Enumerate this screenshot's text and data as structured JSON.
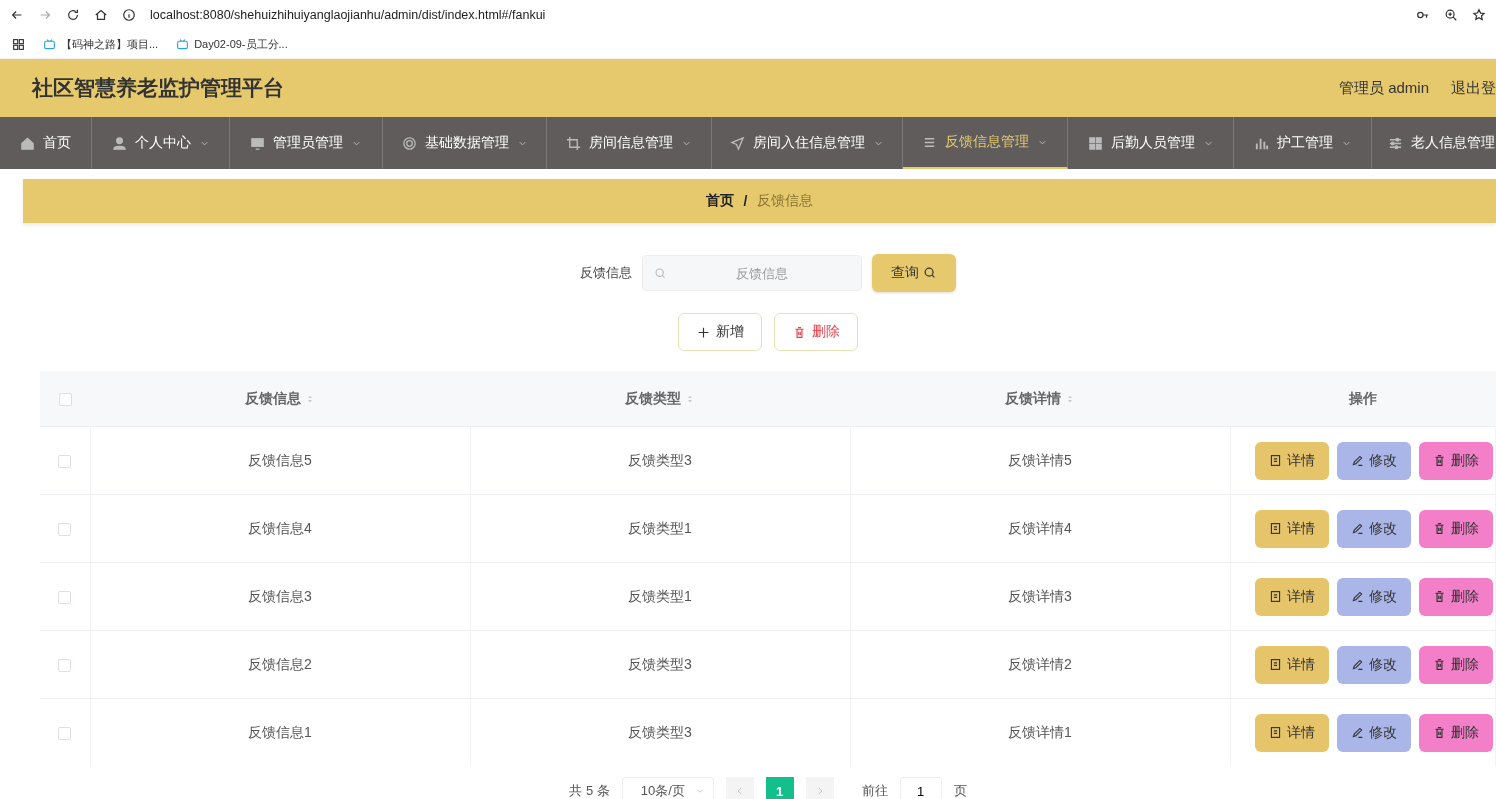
{
  "browser": {
    "url": "localhost:8080/shehuizhihuiyanglaojianhu/admin/dist/index.html#/fankui",
    "bookmarks": [
      "【码神之路】项目...",
      "Day02-09-员工分..."
    ]
  },
  "header": {
    "title": "社区智慧养老监护管理平台",
    "user": "管理员 admin",
    "logout": "退出登"
  },
  "nav": {
    "items": [
      {
        "label": "首页",
        "selected": false,
        "has_dropdown": false
      },
      {
        "label": "个人中心",
        "selected": false,
        "has_dropdown": true
      },
      {
        "label": "管理员管理",
        "selected": false,
        "has_dropdown": true
      },
      {
        "label": "基础数据管理",
        "selected": false,
        "has_dropdown": true
      },
      {
        "label": "房间信息管理",
        "selected": false,
        "has_dropdown": true
      },
      {
        "label": "房间入住信息管理",
        "selected": false,
        "has_dropdown": true
      },
      {
        "label": "反馈信息管理",
        "selected": true,
        "has_dropdown": true
      },
      {
        "label": "后勤人员管理",
        "selected": false,
        "has_dropdown": true
      },
      {
        "label": "护工管理",
        "selected": false,
        "has_dropdown": true
      },
      {
        "label": "老人信息管理",
        "selected": false,
        "has_dropdown": false
      }
    ]
  },
  "breadcrumb": {
    "items": [
      "首页",
      "反馈信息"
    ],
    "separator": "/"
  },
  "search": {
    "label": "反馈信息",
    "placeholder": "反馈信息",
    "button": "查询"
  },
  "toolbar": {
    "add": "新增",
    "delete": "删除"
  },
  "table": {
    "all_checked": false,
    "columns": [
      {
        "label": "反馈信息",
        "sortable": true
      },
      {
        "label": "反馈类型",
        "sortable": true
      },
      {
        "label": "反馈详情",
        "sortable": true
      },
      {
        "label": "操作",
        "sortable": false
      }
    ],
    "rows": [
      {
        "checked": false,
        "cells": [
          "反馈信息5",
          "反馈类型3",
          "反馈详情5"
        ],
        "actions": [
          {
            "kind": "detail",
            "label": "详情"
          },
          {
            "kind": "edit",
            "label": "修改"
          },
          {
            "kind": "delete",
            "label": "删除"
          }
        ]
      },
      {
        "checked": false,
        "cells": [
          "反馈信息4",
          "反馈类型1",
          "反馈详情4"
        ],
        "actions": [
          {
            "kind": "detail",
            "label": "详情"
          },
          {
            "kind": "edit",
            "label": "修改"
          },
          {
            "kind": "delete",
            "label": "删除"
          }
        ]
      },
      {
        "checked": false,
        "cells": [
          "反馈信息3",
          "反馈类型1",
          "反馈详情3"
        ],
        "actions": [
          {
            "kind": "detail",
            "label": "详情"
          },
          {
            "kind": "edit",
            "label": "修改"
          },
          {
            "kind": "delete",
            "label": "删除"
          }
        ]
      },
      {
        "checked": false,
        "cells": [
          "反馈信息2",
          "反馈类型3",
          "反馈详情2"
        ],
        "actions": [
          {
            "kind": "detail",
            "label": "详情"
          },
          {
            "kind": "edit",
            "label": "修改"
          },
          {
            "kind": "delete",
            "label": "删除"
          }
        ]
      },
      {
        "checked": false,
        "cells": [
          "反馈信息1",
          "反馈类型3",
          "反馈详情1"
        ],
        "actions": [
          {
            "kind": "detail",
            "label": "详情"
          },
          {
            "kind": "edit",
            "label": "修改"
          },
          {
            "kind": "delete",
            "label": "删除"
          }
        ]
      }
    ]
  },
  "pagination": {
    "total": "共 5 条",
    "page_size": "10条/页",
    "pages": [
      {
        "label": "1",
        "selected": true
      }
    ],
    "goto_label": "前往",
    "goto_value": "1",
    "page_suffix": "页"
  }
}
